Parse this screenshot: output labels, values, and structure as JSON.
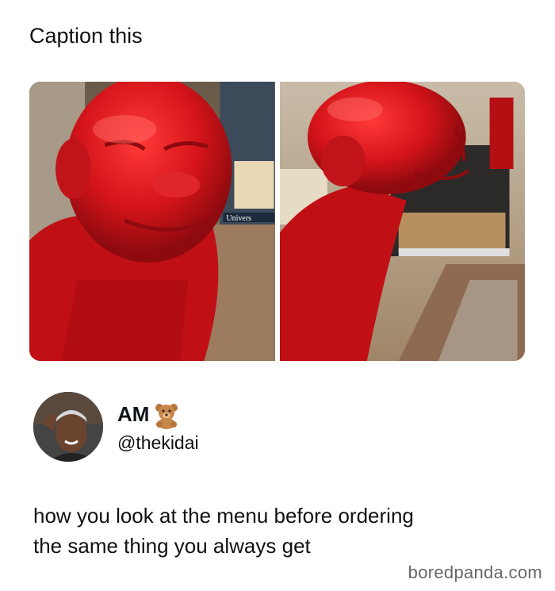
{
  "post": {
    "caption": "Caption this",
    "images": [
      {
        "description_icon": "red-statue-front"
      },
      {
        "description_icon": "red-statue-side"
      }
    ],
    "sign_text": "Univers"
  },
  "author": {
    "name": "AM",
    "emoji": "teddy-bear-icon",
    "handle": "@thekidai"
  },
  "tweet": {
    "line1": "how you look at the menu before ordering",
    "line2": "the same thing you always get"
  },
  "watermark": "boredpanda.com",
  "colors": {
    "statue_red": "#d4141a",
    "text": "#111111",
    "watermark": "#666666"
  }
}
